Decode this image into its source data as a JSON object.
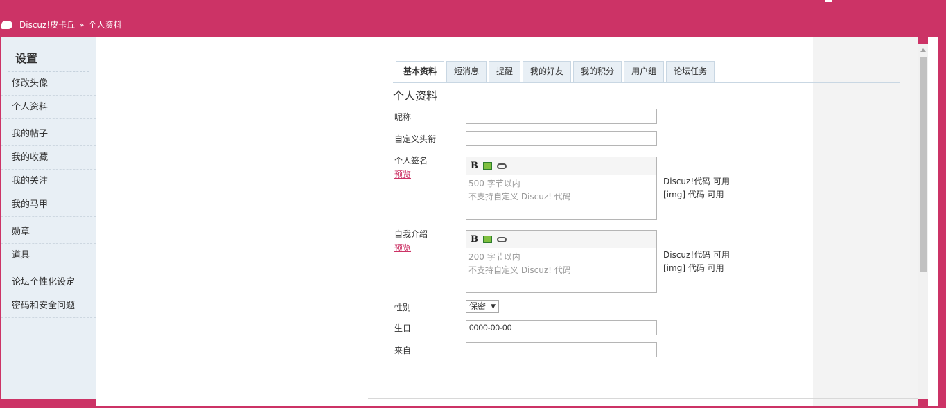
{
  "breadcrumb": {
    "site": "Discuz!皮卡丘",
    "separator": "»",
    "current": "个人资料"
  },
  "sidebar": {
    "title": "设置",
    "items": [
      {
        "label": "修改头像"
      },
      {
        "label": "个人资料"
      },
      {
        "label": "我的帖子"
      },
      {
        "label": "我的收藏"
      },
      {
        "label": "我的关注"
      },
      {
        "label": "我的马甲"
      },
      {
        "label": "勋章"
      },
      {
        "label": "道具"
      },
      {
        "label": "论坛个性化设定"
      },
      {
        "label": "密码和安全问题"
      }
    ]
  },
  "tabs": [
    {
      "label": "基本资料",
      "active": true
    },
    {
      "label": "短消息"
    },
    {
      "label": "提醒"
    },
    {
      "label": "我的好友"
    },
    {
      "label": "我的积分"
    },
    {
      "label": "用户组"
    },
    {
      "label": "论坛任务"
    }
  ],
  "form": {
    "section_title": "个人资料",
    "nickname": {
      "label": "昵称",
      "value": ""
    },
    "custom_title": {
      "label": "自定义头衔",
      "value": ""
    },
    "signature": {
      "label": "个人签名",
      "preview": "预览",
      "placeholder_line1": "500 字节以内",
      "placeholder_line2": "不支持自定义 Discuz! 代码",
      "hint_line1": "Discuz!代码 可用",
      "hint_line2": "[img] 代码 可用"
    },
    "bio": {
      "label": "自我介绍",
      "preview": "预览",
      "placeholder_line1": "200 字节以内",
      "placeholder_line2": "不支持自定义 Discuz! 代码",
      "hint_line1": "Discuz!代码 可用",
      "hint_line2": "[img] 代码 可用"
    },
    "gender": {
      "label": "性别",
      "value": "保密"
    },
    "birthday": {
      "label": "生日",
      "value": "0000-00-00"
    },
    "from": {
      "label": "来自",
      "value": ""
    }
  },
  "editor_toolbar": {
    "bold": "B",
    "icons": [
      "image-icon",
      "link-icon"
    ]
  },
  "colors": {
    "brand": "#cc3366",
    "sidebar_bg": "#e8eff5",
    "tab_bg": "#e8eff5"
  }
}
